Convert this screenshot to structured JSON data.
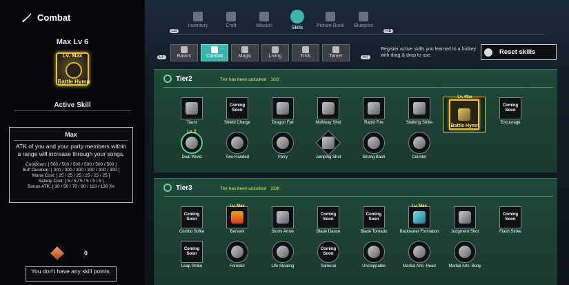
{
  "left": {
    "title": "Combat",
    "max_lv": "Max Lv 6",
    "selected_skill": {
      "level_badge": "Lv. Max",
      "name": "Battle Hymn"
    },
    "active_skill_label": "Active Skill",
    "desc": {
      "title": "Max",
      "text": "ATK of you and your party members within a range will increase through your songs.",
      "stats": [
        "Cooldown: [ 500 / 500 / 500 / 500 / 500 / 500 ]",
        "Buff Duration: [ 300 / 300 / 300 / 300 / 300 / 300 ]",
        "Mana Cost: [ 25 / 25 / 25 / 25 / 25 / 25 ]",
        "Satiety Cost: [ 5 / 5 / 5 / 5 / 5 / 5 ]",
        "Bonus ATK: [ 30 / 50 / 70 / 90 / 110 / 130 ]%"
      ]
    },
    "skill_points": "0",
    "no_points_msg": "You don't have any skill points."
  },
  "topnav": {
    "tabs": [
      "Inventory",
      "Craft",
      "Mission",
      "Skills",
      "Picture Book",
      "Blueprint"
    ],
    "selected": "Skills",
    "left_key": "LB",
    "right_key": "RB"
  },
  "categories": {
    "tabs": [
      "Basics",
      "Combat",
      "Magic",
      "Living",
      "Trick",
      "Tamer"
    ],
    "selected": "Combat",
    "left_key": "LT",
    "right_key": "RT"
  },
  "hint": "Register active skills you learned to a hotkey with drag & drop to use.",
  "reset_label": "Reset skills",
  "tier2": {
    "title": "Tier2",
    "unlock_text": "Tier has been unlocked",
    "unlock_count": "10/2",
    "row1": [
      {
        "name": "Taunt",
        "text": ""
      },
      {
        "name": "Shield Charge",
        "text": "Coming Soon"
      },
      {
        "name": "Dragon Fall",
        "text": ""
      },
      {
        "name": "Multiway Shot",
        "text": ""
      },
      {
        "name": "Rapid Fire",
        "text": ""
      },
      {
        "name": "Stalking Strike",
        "text": ""
      },
      {
        "name": "Battle Hymn",
        "text": "",
        "lvl": "Lv. Max"
      },
      {
        "name": "Encourage",
        "text": "Coming Soon"
      }
    ],
    "row2": [
      {
        "name": "Dual Wield",
        "text": "",
        "lvl": "Lv. 2"
      },
      {
        "name": "Two-Handed",
        "text": ""
      },
      {
        "name": "Parry",
        "text": ""
      },
      {
        "name": "Jumping Shot",
        "text": ""
      },
      {
        "name": "Strong Bash",
        "text": ""
      },
      {
        "name": "Counter",
        "text": ""
      }
    ]
  },
  "tier3": {
    "title": "Tier3",
    "unlock_text": "Tier has been unlocked",
    "unlock_count": "22/8",
    "row1": [
      {
        "name": "Combo Strike",
        "text": "Coming Soon"
      },
      {
        "name": "Berserk",
        "text": "",
        "lvl": "Lv. Max"
      },
      {
        "name": "Storm Arrow",
        "text": ""
      },
      {
        "name": "Blade Dance",
        "text": "Coming Soon"
      },
      {
        "name": "Blade Tornado",
        "text": "Coming Soon"
      },
      {
        "name": "Backwater Formation",
        "text": "",
        "lvl": "Lv. Max"
      },
      {
        "name": "Judgment Shot",
        "text": ""
      },
      {
        "name": "Flash Strike",
        "text": "Coming Soon"
      }
    ],
    "row2": [
      {
        "name": "Leap Strike",
        "text": "Coming Soon"
      },
      {
        "name": "Forester",
        "text": ""
      },
      {
        "name": "Life Stealing",
        "text": ""
      },
      {
        "name": "Samurai",
        "text": "Coming Soon"
      },
      {
        "name": "Unstoppable",
        "text": ""
      },
      {
        "name": "Martial Arts: Head",
        "text": ""
      },
      {
        "name": "Martial Arts: Body",
        "text": ""
      }
    ]
  }
}
